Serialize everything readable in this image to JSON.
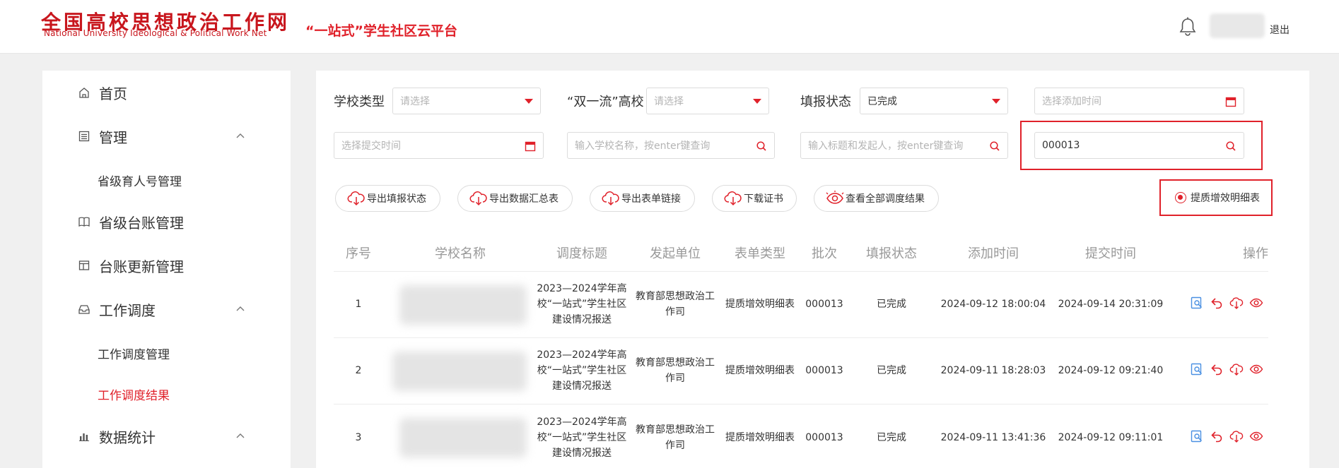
{
  "header": {
    "logo_cn": "全国高校思想政治工作网",
    "logo_en": "National University Ideological & Political Work Net",
    "platform": "“一站式”学生社区云平台",
    "logout": "退出"
  },
  "sidebar": {
    "items": [
      {
        "label": "首页",
        "icon": "home-icon",
        "expandable": false
      },
      {
        "label": "管理",
        "icon": "list-icon",
        "expandable": true
      },
      {
        "label": "省级育人号管理",
        "sub": true
      },
      {
        "label": "省级台账管理",
        "icon": "book-icon",
        "expandable": false
      },
      {
        "label": "台账更新管理",
        "icon": "ledger-icon",
        "expandable": false
      },
      {
        "label": "工作调度",
        "icon": "inbox-icon",
        "expandable": true
      },
      {
        "label": "工作调度管理",
        "sub": true
      },
      {
        "label": "工作调度结果",
        "sub": true,
        "active": true
      },
      {
        "label": "数据统计",
        "icon": "bar-chart-icon",
        "expandable": true
      }
    ]
  },
  "filters": {
    "school_type_label": "学校类型",
    "school_type_placeholder": "请选择",
    "double_first_label": "“双一流”高校",
    "double_first_placeholder": "请选择",
    "status_label": "填报状态",
    "status_value": "已完成",
    "add_time_placeholder": "选择添加时间",
    "submit_time_placeholder": "选择提交时间",
    "school_name_placeholder": "输入学校名称，按enter键查询",
    "title_placeholder": "输入标题和发起人，按enter键查询",
    "batch_value": "000013"
  },
  "toolbar": {
    "export_status": "导出填报状态",
    "export_summary": "导出数据汇总表",
    "export_links": "导出表单链接",
    "download_cert": "下载证书",
    "view_all": "查看全部调度结果",
    "radio_label": "提质增效明细表"
  },
  "table": {
    "headers": [
      "序号",
      "学校名称",
      "调度标题",
      "发起单位",
      "表单类型",
      "批次",
      "填报状态",
      "添加时间",
      "提交时间",
      "操作"
    ],
    "rows": [
      {
        "index": "1",
        "title": "2023—2024学年高校“一站式”学生社区建设情况报送",
        "org": "教育部思想政治工作司",
        "form_type": "提质增效明细表",
        "batch": "000013",
        "status": "已完成",
        "add_time": "2024-09-12 18:00:04",
        "submit_time": "2024-09-14 20:31:09"
      },
      {
        "index": "2",
        "title": "2023—2024学年高校“一站式”学生社区建设情况报送",
        "org": "教育部思想政治工作司",
        "form_type": "提质增效明细表",
        "batch": "000013",
        "status": "已完成",
        "add_time": "2024-09-11 18:28:03",
        "submit_time": "2024-09-12 09:21:40"
      },
      {
        "index": "3",
        "title": "2023—2024学年高校“一站式”学生社区建设情况报送",
        "org": "教育部思想政治工作司",
        "form_type": "提质增效明细表",
        "batch": "000013",
        "status": "已完成",
        "add_time": "2024-09-11 13:41:36",
        "submit_time": "2024-09-12 09:11:01"
      }
    ]
  },
  "colors": {
    "accent": "#e0212a",
    "brand": "#c8161d",
    "action_blue": "#4a90e2"
  }
}
